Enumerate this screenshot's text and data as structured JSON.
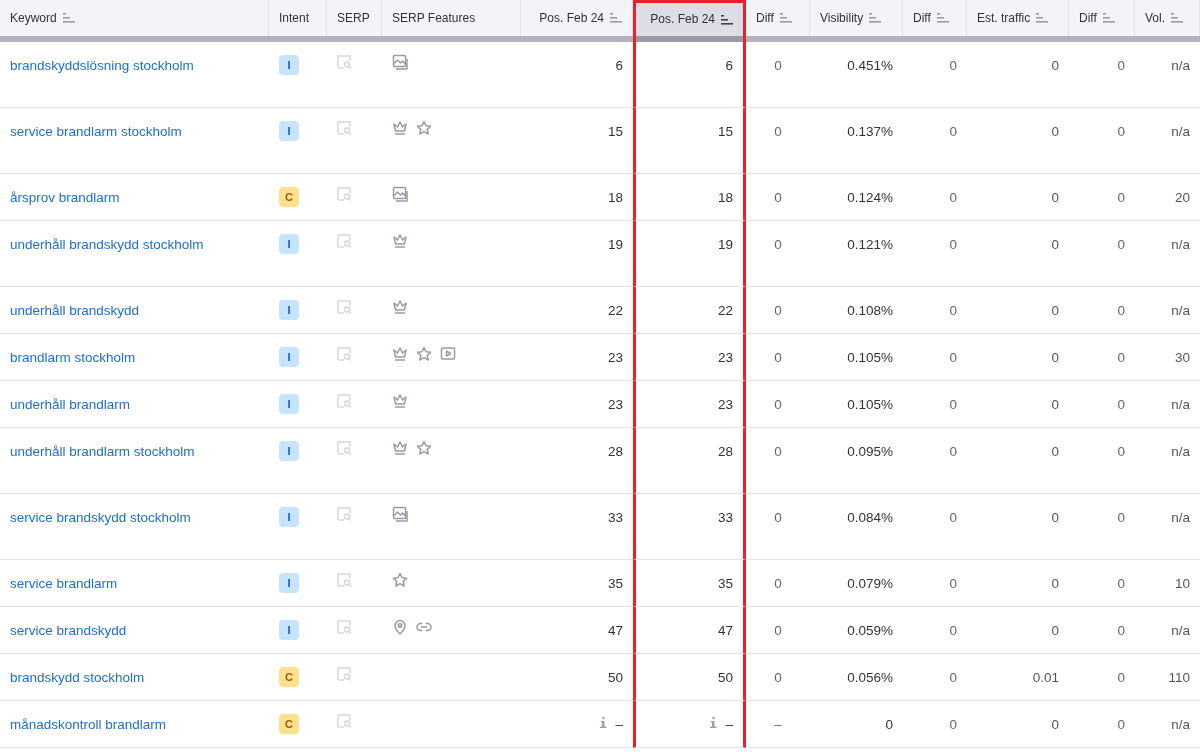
{
  "columns": [
    {
      "label": "Keyword",
      "sortable": true,
      "selected": false,
      "highlight": false
    },
    {
      "label": "Intent",
      "sortable": false,
      "selected": false,
      "highlight": false
    },
    {
      "label": "SERP",
      "sortable": false,
      "selected": false,
      "highlight": false
    },
    {
      "label": "SERP Features",
      "sortable": false,
      "selected": false,
      "highlight": false
    },
    {
      "label": "Pos. Feb 24",
      "sortable": true,
      "selected": false,
      "highlight": false
    },
    {
      "label": "Pos. Feb 24",
      "sortable": true,
      "selected": true,
      "highlight": true
    },
    {
      "label": "Diff",
      "sortable": true,
      "selected": false,
      "highlight": false
    },
    {
      "label": "Visibility",
      "sortable": true,
      "selected": false,
      "highlight": false
    },
    {
      "label": "Diff",
      "sortable": true,
      "selected": false,
      "highlight": false
    },
    {
      "label": "Est. traffic",
      "sortable": true,
      "selected": false,
      "highlight": false
    },
    {
      "label": "Diff",
      "sortable": true,
      "selected": false,
      "highlight": false
    },
    {
      "label": "Vol.",
      "sortable": true,
      "selected": false,
      "highlight": false
    }
  ],
  "rows": [
    {
      "keyword": "brandskyddslösning stockholm",
      "intent": "I",
      "expanded": true,
      "features": [
        {
          "kind": "image"
        }
      ],
      "pos": [
        {
          "text": "6",
          "info": false
        },
        {
          "text": "6",
          "info": false
        }
      ],
      "diff": "0",
      "visibility": "0.451%",
      "visibility_diff": "0",
      "traffic": "0",
      "traffic_diff": "0",
      "volume": "n/a"
    },
    {
      "keyword": "service brandlarm stockholm",
      "intent": "I",
      "expanded": true,
      "features": [
        {
          "kind": "crown"
        },
        {
          "kind": "star"
        }
      ],
      "pos": [
        {
          "text": "15",
          "info": false
        },
        {
          "text": "15",
          "info": false
        }
      ],
      "diff": "0",
      "visibility": "0.137%",
      "visibility_diff": "0",
      "traffic": "0",
      "traffic_diff": "0",
      "volume": "n/a"
    },
    {
      "keyword": "årsprov brandlarm",
      "intent": "C",
      "expanded": false,
      "features": [
        {
          "kind": "image"
        }
      ],
      "pos": [
        {
          "text": "18",
          "info": false
        },
        {
          "text": "18",
          "info": false
        }
      ],
      "diff": "0",
      "visibility": "0.124%",
      "visibility_diff": "0",
      "traffic": "0",
      "traffic_diff": "0",
      "volume": "20"
    },
    {
      "keyword": "underhåll brandskydd stockholm",
      "intent": "I",
      "expanded": true,
      "features": [
        {
          "kind": "crown"
        }
      ],
      "pos": [
        {
          "text": "19",
          "info": false
        },
        {
          "text": "19",
          "info": false
        }
      ],
      "diff": "0",
      "visibility": "0.121%",
      "visibility_diff": "0",
      "traffic": "0",
      "traffic_diff": "0",
      "volume": "n/a"
    },
    {
      "keyword": "underhåll brandskydd",
      "intent": "I",
      "expanded": false,
      "features": [
        {
          "kind": "crown"
        }
      ],
      "pos": [
        {
          "text": "22",
          "info": false
        },
        {
          "text": "22",
          "info": false
        }
      ],
      "diff": "0",
      "visibility": "0.108%",
      "visibility_diff": "0",
      "traffic": "0",
      "traffic_diff": "0",
      "volume": "n/a"
    },
    {
      "keyword": "brandlarm stockholm",
      "intent": "I",
      "expanded": false,
      "features": [
        {
          "kind": "crown"
        },
        {
          "kind": "star"
        },
        {
          "kind": "video"
        }
      ],
      "pos": [
        {
          "text": "23",
          "info": false
        },
        {
          "text": "23",
          "info": false
        }
      ],
      "diff": "0",
      "visibility": "0.105%",
      "visibility_diff": "0",
      "traffic": "0",
      "traffic_diff": "0",
      "volume": "30"
    },
    {
      "keyword": "underhåll brandlarm",
      "intent": "I",
      "expanded": false,
      "features": [
        {
          "kind": "crown"
        }
      ],
      "pos": [
        {
          "text": "23",
          "info": false
        },
        {
          "text": "23",
          "info": false
        }
      ],
      "diff": "0",
      "visibility": "0.105%",
      "visibility_diff": "0",
      "traffic": "0",
      "traffic_diff": "0",
      "volume": "n/a"
    },
    {
      "keyword": "underhåll brandlarm stockholm",
      "intent": "I",
      "expanded": true,
      "features": [
        {
          "kind": "crown"
        },
        {
          "kind": "star"
        }
      ],
      "pos": [
        {
          "text": "28",
          "info": false
        },
        {
          "text": "28",
          "info": false
        }
      ],
      "diff": "0",
      "visibility": "0.095%",
      "visibility_diff": "0",
      "traffic": "0",
      "traffic_diff": "0",
      "volume": "n/a"
    },
    {
      "keyword": "service brandskydd stockholm",
      "intent": "I",
      "expanded": true,
      "features": [
        {
          "kind": "image"
        }
      ],
      "pos": [
        {
          "text": "33",
          "info": false
        },
        {
          "text": "33",
          "info": false
        }
      ],
      "diff": "0",
      "visibility": "0.084%",
      "visibility_diff": "0",
      "traffic": "0",
      "traffic_diff": "0",
      "volume": "n/a"
    },
    {
      "keyword": "service brandlarm",
      "intent": "I",
      "expanded": false,
      "features": [
        {
          "kind": "star"
        }
      ],
      "pos": [
        {
          "text": "35",
          "info": false
        },
        {
          "text": "35",
          "info": false
        }
      ],
      "diff": "0",
      "visibility": "0.079%",
      "visibility_diff": "0",
      "traffic": "0",
      "traffic_diff": "0",
      "volume": "10"
    },
    {
      "keyword": "service brandskydd",
      "intent": "I",
      "expanded": false,
      "features": [
        {
          "kind": "pin"
        },
        {
          "kind": "link"
        }
      ],
      "pos": [
        {
          "text": "47",
          "info": false
        },
        {
          "text": "47",
          "info": false
        }
      ],
      "diff": "0",
      "visibility": "0.059%",
      "visibility_diff": "0",
      "traffic": "0",
      "traffic_diff": "0",
      "volume": "n/a"
    },
    {
      "keyword": "brandskydd stockholm",
      "intent": "C",
      "expanded": false,
      "features": [],
      "pos": [
        {
          "text": "50",
          "info": false
        },
        {
          "text": "50",
          "info": false
        }
      ],
      "diff": "0",
      "visibility": "0.056%",
      "visibility_diff": "0",
      "traffic": "0.01",
      "traffic_diff": "0",
      "volume": "110"
    },
    {
      "keyword": "månadskontroll brandlarm",
      "intent": "C",
      "expanded": false,
      "features": [],
      "pos": [
        {
          "text": "–",
          "info": true
        },
        {
          "text": "–",
          "info": true
        }
      ],
      "diff": "–",
      "visibility": "0",
      "visibility_diff": "0",
      "traffic": "0",
      "traffic_diff": "0",
      "volume": "n/a"
    }
  ]
}
